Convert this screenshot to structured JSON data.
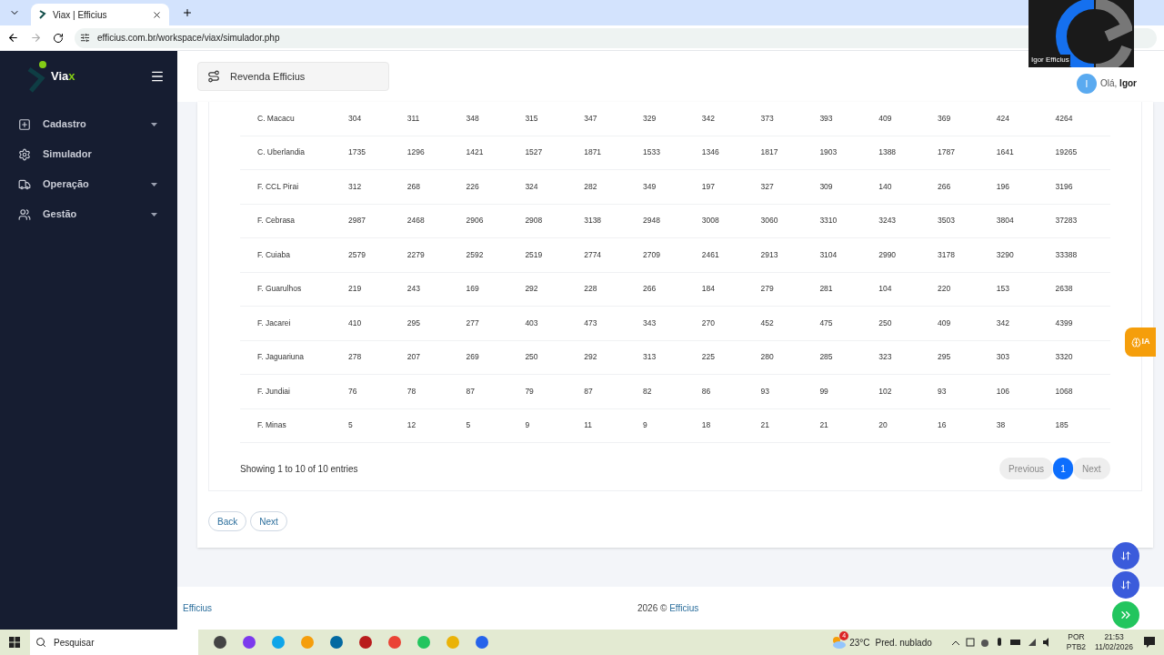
{
  "browser": {
    "tab_title": "Viax | Efficius",
    "url": "efficius.com.br/workspace/viax/simulador.php"
  },
  "sidebar": {
    "logo": "Via",
    "logo_accent": "x",
    "items": [
      {
        "label": "Cadastro",
        "has_submenu": true
      },
      {
        "label": "Simulador",
        "has_submenu": false
      },
      {
        "label": "Operação",
        "has_submenu": true
      },
      {
        "label": "Gestão",
        "has_submenu": true
      }
    ]
  },
  "header": {
    "company": "Revenda Efficius",
    "greeting": "Olá, ",
    "user": "Igor",
    "avatar": "I"
  },
  "video_overlay": {
    "name": "Igor Efficius"
  },
  "table": {
    "rows": [
      [
        "C. Macacu",
        "304",
        "311",
        "348",
        "315",
        "347",
        "329",
        "342",
        "373",
        "393",
        "409",
        "369",
        "424",
        "4264"
      ],
      [
        "C. Uberlandia",
        "1735",
        "1296",
        "1421",
        "1527",
        "1871",
        "1533",
        "1346",
        "1817",
        "1903",
        "1388",
        "1787",
        "1641",
        "19265"
      ],
      [
        "F. CCL Pirai",
        "312",
        "268",
        "226",
        "324",
        "282",
        "349",
        "197",
        "327",
        "309",
        "140",
        "266",
        "196",
        "3196"
      ],
      [
        "F. Cebrasa",
        "2987",
        "2468",
        "2906",
        "2908",
        "3138",
        "2948",
        "3008",
        "3060",
        "3310",
        "3243",
        "3503",
        "3804",
        "37283"
      ],
      [
        "F. Cuiaba",
        "2579",
        "2279",
        "2592",
        "2519",
        "2774",
        "2709",
        "2461",
        "2913",
        "3104",
        "2990",
        "3178",
        "3290",
        "33388"
      ],
      [
        "F. Guarulhos",
        "219",
        "243",
        "169",
        "292",
        "228",
        "266",
        "184",
        "279",
        "281",
        "104",
        "220",
        "153",
        "2638"
      ],
      [
        "F. Jacarei",
        "410",
        "295",
        "277",
        "403",
        "473",
        "343",
        "270",
        "452",
        "475",
        "250",
        "409",
        "342",
        "4399"
      ],
      [
        "F. Jaguariuna",
        "278",
        "207",
        "269",
        "250",
        "292",
        "313",
        "225",
        "280",
        "285",
        "323",
        "295",
        "303",
        "3320"
      ],
      [
        "F. Jundiai",
        "76",
        "78",
        "87",
        "79",
        "87",
        "82",
        "86",
        "93",
        "99",
        "102",
        "93",
        "106",
        "1068"
      ],
      [
        "F. Minas",
        "5",
        "12",
        "5",
        "9",
        "11",
        "9",
        "18",
        "21",
        "21",
        "20",
        "16",
        "38",
        "185"
      ]
    ],
    "info": "Showing 1 to 10 of 10 entries",
    "pagination": [
      {
        "label": "Previous",
        "kind": "nav",
        "selected": false
      },
      {
        "label": "1",
        "kind": "page",
        "selected": true
      },
      {
        "label": "Next",
        "kind": "nav",
        "selected": false
      }
    ]
  },
  "actions": [
    "Back",
    "Next"
  ],
  "ia_tab": "IA",
  "footer": {
    "left": "Efficius",
    "year": "2026 © ",
    "brand": "Efficius"
  },
  "taskbar": {
    "search": "Pesquisar",
    "temperature": "23°C",
    "weather": "Pred. nublado",
    "weather_badge": "4",
    "lang": "POR",
    "layout": "PTB2",
    "time": "21:53",
    "date": "11/02/2026"
  }
}
